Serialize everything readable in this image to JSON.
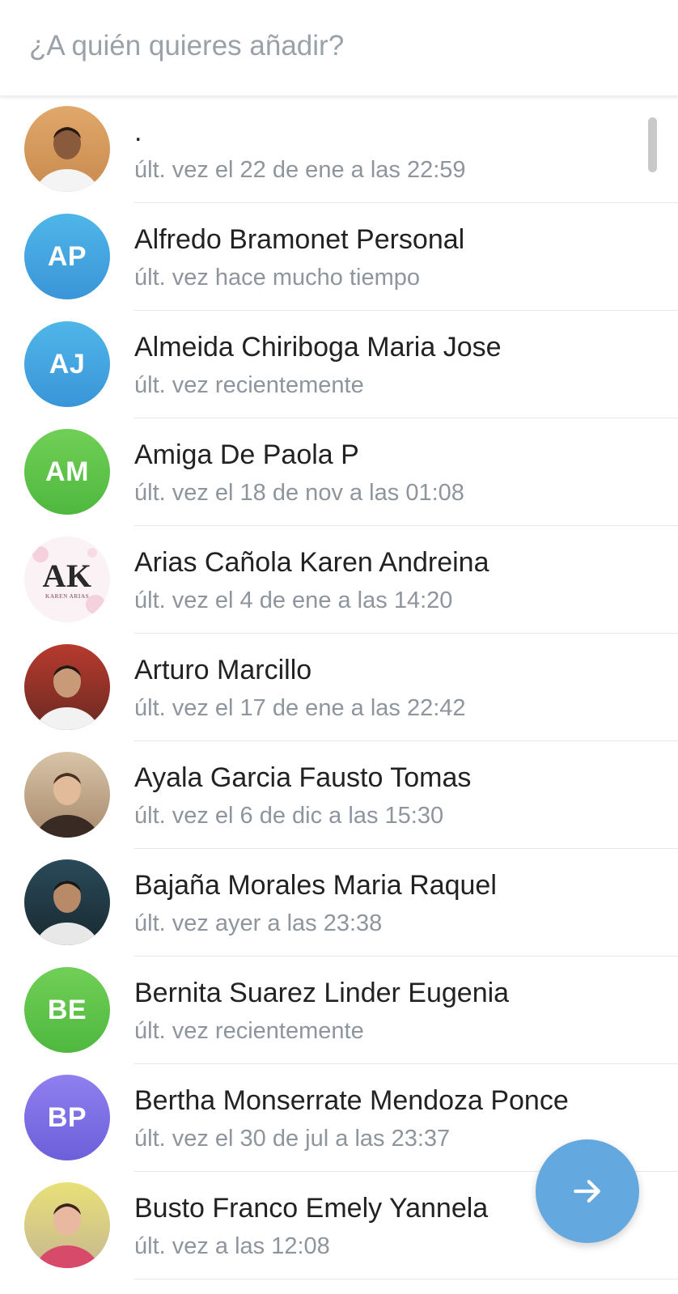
{
  "search": {
    "placeholder": "¿A quién quieres añadir?",
    "value": ""
  },
  "contacts": [
    {
      "name": ".",
      "status": "últ. vez el 22 de ene a las 22:59",
      "avatar_type": "photo",
      "avatar_icon": "person-photo-white-shirt"
    },
    {
      "name": "Alfredo Bramonet Personal",
      "status": "últ. vez hace mucho tiempo",
      "avatar_type": "initials",
      "initials": "AP",
      "color_top": "#4fb6e8",
      "color_bottom": "#3a95d8"
    },
    {
      "name": "Almeida Chiriboga Maria Jose",
      "status": "últ. vez recientemente",
      "avatar_type": "initials",
      "initials": "AJ",
      "color_top": "#4fb6e8",
      "color_bottom": "#3a95d8"
    },
    {
      "name": "Amiga De Paola P",
      "status": "últ. vez el 18 de nov a las 01:08",
      "avatar_type": "initials",
      "initials": "AM",
      "color_top": "#70cf56",
      "color_bottom": "#4fb83f"
    },
    {
      "name": "Arias Cañola Karen Andreina",
      "status": "últ. vez el 4 de ene a las 14:20",
      "avatar_type": "logo",
      "logo_text": "AK",
      "logo_subtext": "KAREN ARIAS"
    },
    {
      "name": "Arturo Marcillo",
      "status": "últ. vez el 17 de ene a las 22:42",
      "avatar_type": "photo",
      "avatar_icon": "person-photo-red-background"
    },
    {
      "name": "Ayala Garcia Fausto Tomas",
      "status": "últ. vez el 6 de dic a las 15:30",
      "avatar_type": "photo",
      "avatar_icon": "person-photo-woman"
    },
    {
      "name": "Bajaña Morales Maria Raquel",
      "status": "últ. vez ayer a las 23:38",
      "avatar_type": "photo",
      "avatar_icon": "group-photo-band"
    },
    {
      "name": "Bernita Suarez Linder Eugenia",
      "status": "últ. vez recientemente",
      "avatar_type": "initials",
      "initials": "BE",
      "color_top": "#70cf56",
      "color_bottom": "#4fb83f"
    },
    {
      "name": "Bertha Monserrate Mendoza Ponce",
      "status": "últ. vez el 30 de jul a las 23:37",
      "avatar_type": "initials",
      "initials": "BP",
      "color_top": "#8f7ff0",
      "color_bottom": "#6c5fd8"
    },
    {
      "name": "Busto Franco Emely Yannela",
      "status": "últ. vez a las 12:08",
      "avatar_type": "photo",
      "avatar_icon": "person-photo-child"
    }
  ],
  "fab": {
    "icon": "arrow-right-icon",
    "color": "#64a8e0"
  }
}
